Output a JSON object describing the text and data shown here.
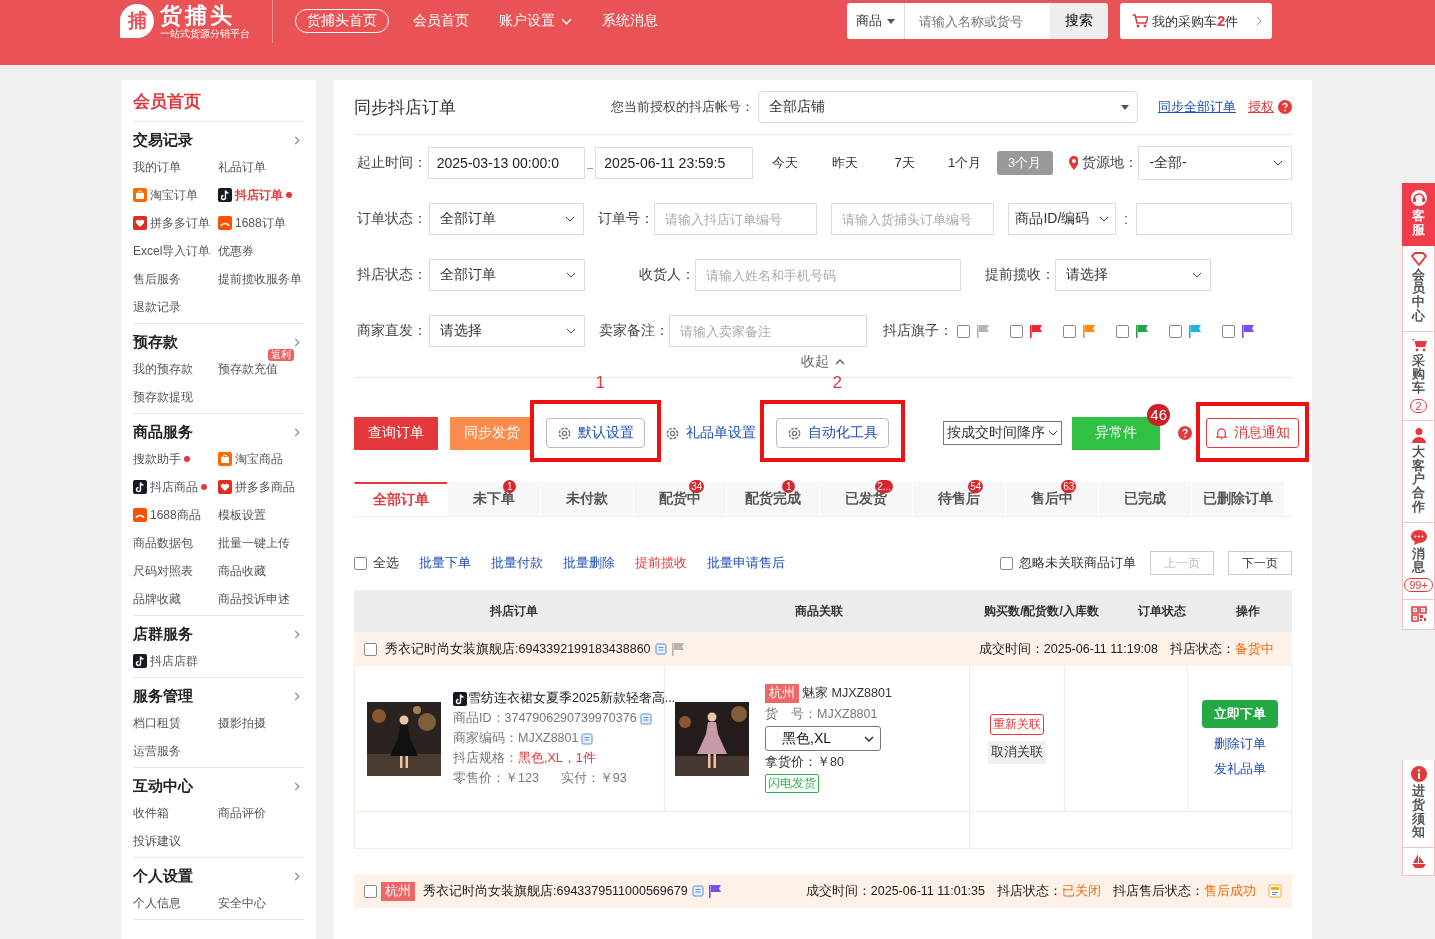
{
  "header": {
    "logo": {
      "mark": "捕",
      "name": "货捕头",
      "slogan": "一站式货源分销平台"
    },
    "home_button": "货捕头首页",
    "nav": [
      {
        "label": "会员首页",
        "dropdown": false
      },
      {
        "label": "账户设置",
        "dropdown": true
      },
      {
        "label": "系统消息",
        "dropdown": false
      }
    ],
    "search": {
      "category": "商品",
      "placeholder": "请输入名称或货号",
      "button": "搜索"
    },
    "cart": {
      "label": "我的采购车",
      "count": "2",
      "unit": "件"
    }
  },
  "sidebar": {
    "title": "会员首页",
    "sections": [
      {
        "title": "交易记录",
        "items": [
          {
            "label": "我的订单",
            "kind": "text",
            "selected": false,
            "dot": false
          },
          {
            "label": "礼品订单",
            "kind": "text",
            "selected": false,
            "dot": false
          },
          {
            "label": "淘宝订单",
            "kind": "taobao",
            "selected": false,
            "dot": false
          },
          {
            "label": "抖店订单",
            "kind": "douyin",
            "selected": true,
            "dot": true
          },
          {
            "label": "拼多多订单",
            "kind": "pdd",
            "selected": false,
            "dot": false
          },
          {
            "label": "1688订单",
            "kind": "ali",
            "selected": false,
            "dot": false
          },
          {
            "label": "Excel导入订单",
            "kind": "text",
            "selected": false,
            "dot": false
          },
          {
            "label": "优惠券",
            "kind": "text",
            "selected": false,
            "dot": false
          },
          {
            "label": "售后服务",
            "kind": "text",
            "selected": false,
            "dot": false
          },
          {
            "label": "提前揽收服务单",
            "kind": "text",
            "selected": false,
            "dot": false
          },
          {
            "label": "退款记录",
            "kind": "text",
            "selected": false,
            "dot": false
          }
        ]
      },
      {
        "title": "预存款",
        "items": [
          {
            "label": "我的预存款",
            "kind": "text",
            "selected": false,
            "dot": false
          },
          {
            "label": "预存款充值",
            "kind": "text",
            "badge": "返利",
            "selected": false,
            "dot": false
          },
          {
            "label": "预存款提现",
            "kind": "text",
            "selected": false,
            "dot": false
          }
        ]
      },
      {
        "title": "商品服务",
        "items": [
          {
            "label": "搜款助手",
            "kind": "text",
            "selected": false,
            "dot": true
          },
          {
            "label": "淘宝商品",
            "kind": "taobao",
            "selected": false,
            "dot": false
          },
          {
            "label": "抖店商品",
            "kind": "douyin",
            "selected": false,
            "dot": true
          },
          {
            "label": "拼多多商品",
            "kind": "pdd",
            "selected": false,
            "dot": false
          },
          {
            "label": "1688商品",
            "kind": "ali",
            "selected": false,
            "dot": false
          },
          {
            "label": "模板设置",
            "kind": "text",
            "selected": false,
            "dot": false
          },
          {
            "label": "商品数据包",
            "kind": "text",
            "selected": false,
            "dot": false
          },
          {
            "label": "批量一键上传",
            "kind": "text",
            "selected": false,
            "dot": false
          },
          {
            "label": "尺码对照表",
            "kind": "text",
            "selected": false,
            "dot": false
          },
          {
            "label": "商品收藏",
            "kind": "text",
            "selected": false,
            "dot": false
          },
          {
            "label": "品牌收藏",
            "kind": "text",
            "selected": false,
            "dot": false
          },
          {
            "label": "商品投诉申述",
            "kind": "text",
            "selected": false,
            "dot": false
          }
        ]
      },
      {
        "title": "店群服务",
        "items": [
          {
            "label": "抖店店群",
            "kind": "douyin",
            "selected": false,
            "dot": false
          }
        ]
      },
      {
        "title": "服务管理",
        "items": [
          {
            "label": "档口租赁",
            "kind": "text",
            "selected": false,
            "dot": false
          },
          {
            "label": "摄影拍摄",
            "kind": "text",
            "selected": false,
            "dot": false
          },
          {
            "label": "运营服务",
            "kind": "text",
            "selected": false,
            "dot": false
          }
        ]
      },
      {
        "title": "互动中心",
        "items": [
          {
            "label": "收件箱",
            "kind": "text",
            "selected": false,
            "dot": false
          },
          {
            "label": "商品评价",
            "kind": "text",
            "selected": false,
            "dot": false
          },
          {
            "label": "投诉建议",
            "kind": "text",
            "selected": false,
            "dot": false
          }
        ]
      },
      {
        "title": "个人设置",
        "items": [
          {
            "label": "个人信息",
            "kind": "text",
            "selected": false,
            "dot": false
          },
          {
            "label": "安全中心",
            "kind": "text",
            "selected": false,
            "dot": false
          }
        ]
      }
    ]
  },
  "main": {
    "title": "同步抖店订单",
    "account_label": "您当前授权的抖店帐号：",
    "account_value": "全部店铺",
    "sync_link": "同步全部订单",
    "auth_link": "授权",
    "filters": {
      "time_label": "起止时间：",
      "start": "2025-03-13 00:00:0",
      "end": "2025-06-11 23:59:5",
      "ranges": [
        {
          "label": "今天",
          "selected": false
        },
        {
          "label": "昨天",
          "selected": false
        },
        {
          "label": "7天",
          "selected": false
        },
        {
          "label": "1个月",
          "selected": false
        },
        {
          "label": "3个月",
          "selected": true
        }
      ],
      "origin_label": "货源地：",
      "origin_value": "-全部-",
      "order_status_label": "订单状态：",
      "order_status_value": "全部订单",
      "order_no_label": "订单号：",
      "order_no_placeholder": "请输入抖店订单编号",
      "hbt_no_placeholder": "请输入货捕头订单编号",
      "product_select": "商品ID/编码",
      "colon": ":",
      "shop_status_label": "抖店状态：",
      "shop_status_value": "全部订单",
      "receiver_label": "收货人：",
      "receiver_placeholder": "请输入姓名和手机号码",
      "pickup_label": "提前揽收：",
      "pickup_value": "请选择",
      "direct_label": "商家直发：",
      "direct_value": "请选择",
      "remark_label": "卖家备注：",
      "remark_placeholder": "请输入卖家备注",
      "flags_label": "抖店旗子：",
      "flags": [
        {
          "color": "#b5b5b5",
          "checked": false
        },
        {
          "color": "#f5222d",
          "checked": false
        },
        {
          "color": "#fa8c16",
          "checked": false
        },
        {
          "color": "#24a34a",
          "checked": false
        },
        {
          "color": "#1cb5d6",
          "checked": false
        },
        {
          "color": "#7a4df0",
          "checked": false
        }
      ],
      "collapse": "收起"
    },
    "toolbar": [
      {
        "kind": "primary",
        "label": "查询订单",
        "highlighted": false
      },
      {
        "kind": "warning",
        "label": "同步发货",
        "highlighted": false
      },
      {
        "kind": "gear",
        "label": "默认设置",
        "highlighted": true,
        "marker": "1"
      },
      {
        "kind": "gear",
        "label": "礼品单设置",
        "highlighted": false
      },
      {
        "kind": "gear",
        "label": "自动化工具",
        "highlighted": true,
        "marker": "2"
      },
      {
        "kind": "select",
        "label": "按成交时间降序",
        "highlighted": false
      },
      {
        "kind": "success",
        "label": "异常件",
        "badge": "46",
        "highlighted": false
      },
      {
        "kind": "help",
        "highlighted": false
      },
      {
        "kind": "bell",
        "label": "消息通知",
        "highlighted": true
      }
    ],
    "tabs": [
      {
        "label": "全部订单",
        "selected": true
      },
      {
        "label": "未下单",
        "badge": "1",
        "selected": false
      },
      {
        "label": "未付款",
        "selected": false
      },
      {
        "label": "配货中",
        "badge": "34",
        "selected": false
      },
      {
        "label": "配货完成",
        "badge": "1",
        "selected": false
      },
      {
        "label": "已发货",
        "badge": "2...",
        "selected": false
      },
      {
        "label": "待售后",
        "badge": "54",
        "selected": false
      },
      {
        "label": "售后中",
        "badge": "63",
        "selected": false
      },
      {
        "label": "已完成",
        "selected": false
      },
      {
        "label": "已删除订单",
        "selected": false
      }
    ],
    "batch": {
      "select_all": "全选",
      "checked": false,
      "actions": [
        {
          "label": "批量下单",
          "kind": "link"
        },
        {
          "label": "批量付款",
          "kind": "link"
        },
        {
          "label": "批量删除",
          "kind": "link"
        },
        {
          "label": "提前揽收",
          "kind": "alert"
        },
        {
          "label": "批量申请售后",
          "kind": "link"
        }
      ],
      "ignore": "忽略未关联商品订单",
      "ignore_checked": false,
      "prev": "上一页",
      "prev_disabled": true,
      "next": "下一页",
      "next_disabled": false
    },
    "table": {
      "columns": [
        "抖店订单",
        "商品关联",
        "购买数/配货数/入库数",
        "订单状态",
        "操作"
      ],
      "orders": [
        {
          "checked": false,
          "shop": "秀衣记时尚女装旗舰店:6943392199183438860",
          "color": "#b5b5b5",
          "time": "成交时间：2025-06-11 11:19:08",
          "status_label": "抖店状态：",
          "status": "备货中",
          "product": {
            "title": "雪纺连衣裙女夏季2025新款轻奢高...",
            "id": "商品ID：3747906290739970376",
            "code": "商家编码：MJXZ8801",
            "spec_label": "抖店规格：",
            "spec": "黑色,XL，1件",
            "retail": "零售价：￥123",
            "paid": "实付：￥93"
          },
          "linked": {
            "city": "杭州",
            "supplier": "魅家 MJXZ8801",
            "sku": "货　号：MJXZ8801",
            "variant": "黑色,XL",
            "price": "拿货价：￥80",
            "tag": "闪电发货"
          },
          "relink": "重新关联",
          "unlink": "取消关联",
          "actions": [
            "立即下单",
            "删除订单",
            "发礼品单"
          ]
        },
        {
          "checked": false,
          "city": "杭州",
          "shop": "秀衣记时尚女装旗舰店:6943379511000569679",
          "color": "#7a4df0",
          "time": "成交时间：2025-06-11 11:01:35",
          "status_label": "抖店状态：",
          "status": "已关闭",
          "after_label": "抖店售后状态：",
          "after": "售后成功"
        }
      ]
    }
  },
  "floatbar": [
    {
      "kind": "service",
      "label": "客服",
      "selected": true
    },
    {
      "kind": "vip",
      "label": "会员中心",
      "selected": false
    },
    {
      "kind": "cart",
      "label": "采购车",
      "badge": "2",
      "selected": false
    },
    {
      "kind": "user",
      "label": "大客户合作",
      "selected": false
    },
    {
      "kind": "chat",
      "label": "消息",
      "badge": "99+",
      "selected": false
    },
    {
      "kind": "qr",
      "selected": false
    },
    {
      "kind": "info",
      "label": "进货须知",
      "selected": false
    },
    {
      "kind": "boat",
      "selected": false
    }
  ]
}
